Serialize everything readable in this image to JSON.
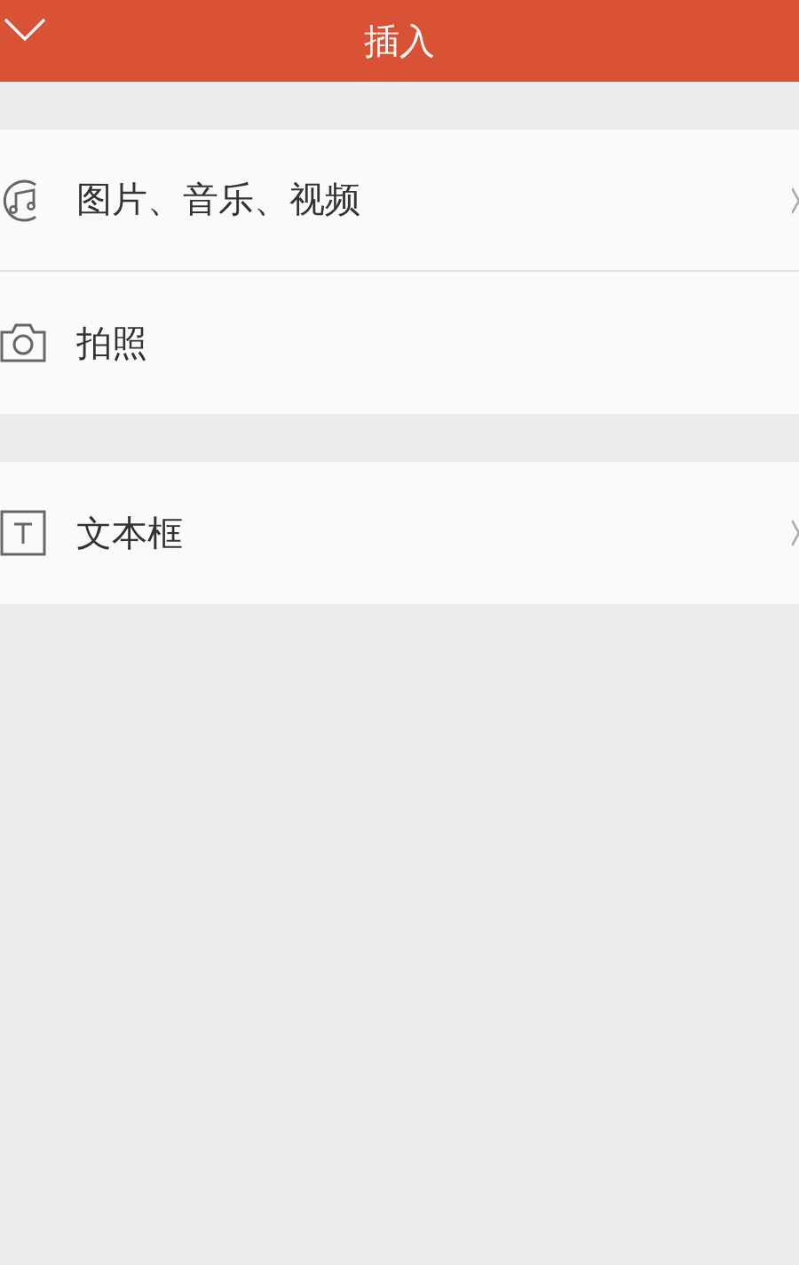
{
  "header": {
    "title": "插入"
  },
  "groups": [
    {
      "items": [
        {
          "kind": "media",
          "label": "图片、音乐、视频",
          "chevron": true
        },
        {
          "kind": "camera",
          "label": "拍照",
          "chevron": false
        }
      ]
    },
    {
      "items": [
        {
          "kind": "text",
          "label": "文本框",
          "chevron": true
        }
      ]
    }
  ]
}
